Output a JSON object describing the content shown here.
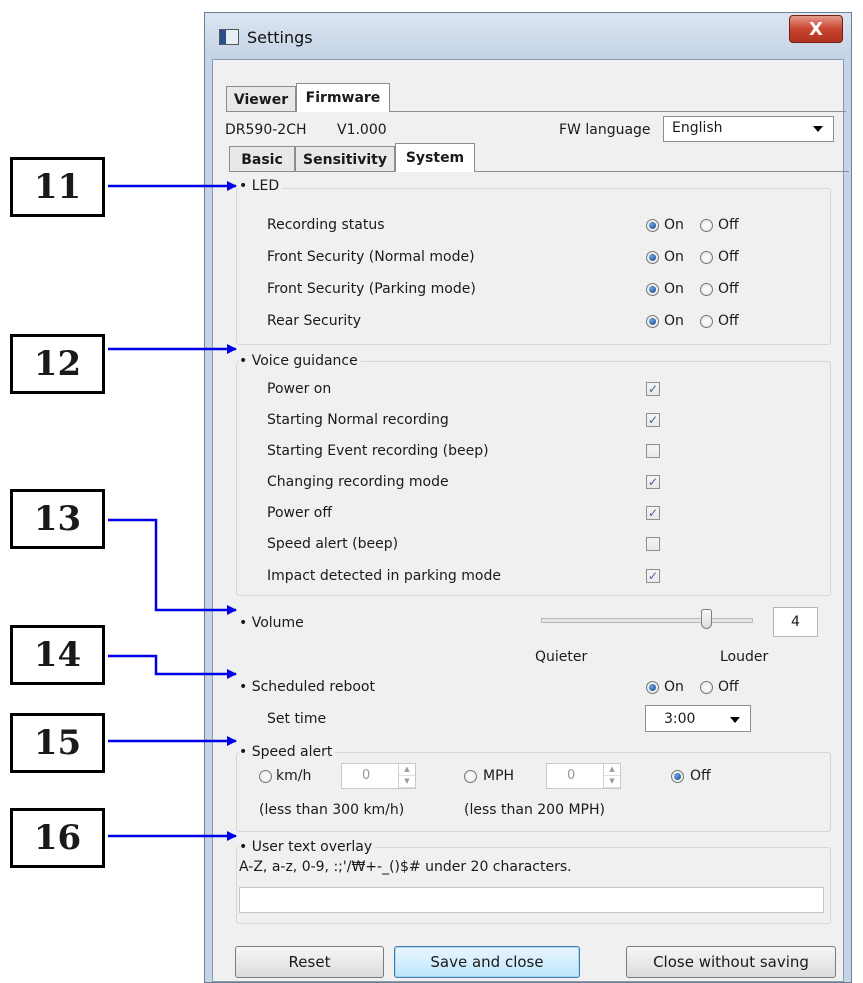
{
  "callouts": [
    "11",
    "12",
    "13",
    "14",
    "15",
    "16"
  ],
  "window": {
    "title": "Settings",
    "close_glyph": "X"
  },
  "top_tabs": [
    "Viewer",
    "Firmware"
  ],
  "device": {
    "model": "DR590-2CH",
    "version": "V1.000"
  },
  "fw_language": {
    "label": "FW language",
    "value": "English"
  },
  "sub_tabs": [
    "Basic",
    "Sensitivity",
    "System"
  ],
  "led": {
    "title": "LED",
    "on_label": "On",
    "off_label": "Off",
    "rows": [
      {
        "label": "Recording status",
        "state": "On"
      },
      {
        "label": "Front Security (Normal mode)",
        "state": "On"
      },
      {
        "label": "Front Security (Parking mode)",
        "state": "On"
      },
      {
        "label": "Rear Security",
        "state": "On"
      }
    ]
  },
  "voice": {
    "title": "Voice guidance",
    "rows": [
      {
        "label": "Power on",
        "checked": true
      },
      {
        "label": "Starting Normal recording",
        "checked": true
      },
      {
        "label": "Starting Event recording (beep)",
        "checked": false
      },
      {
        "label": "Changing recording mode",
        "checked": true
      },
      {
        "label": "Power off",
        "checked": true
      },
      {
        "label": "Speed alert (beep)",
        "checked": false
      },
      {
        "label": "Impact detected in parking mode",
        "checked": true
      }
    ]
  },
  "volume": {
    "title": "Volume",
    "value": "4",
    "level_fraction": 0.8,
    "quieter": "Quieter",
    "louder": "Louder"
  },
  "reboot": {
    "title": "Scheduled reboot",
    "state": "On",
    "set_time_label": "Set time",
    "set_time_value": "3:00"
  },
  "speed_alert": {
    "title": "Speed alert",
    "kmh_label": "km/h",
    "kmh_value": "0",
    "kmh_note": "(less than 300 km/h)",
    "mph_label": "MPH",
    "mph_value": "0",
    "mph_note": "(less than 200 MPH)",
    "off_label": "Off",
    "selected": "Off"
  },
  "overlay": {
    "title": "User text overlay",
    "hint": "A-Z, a-z, 0-9, :;'/₩+-_()$# under 20 characters.",
    "value": ""
  },
  "buttons": {
    "reset": "Reset",
    "save": "Save and close",
    "close": "Close without saving"
  }
}
